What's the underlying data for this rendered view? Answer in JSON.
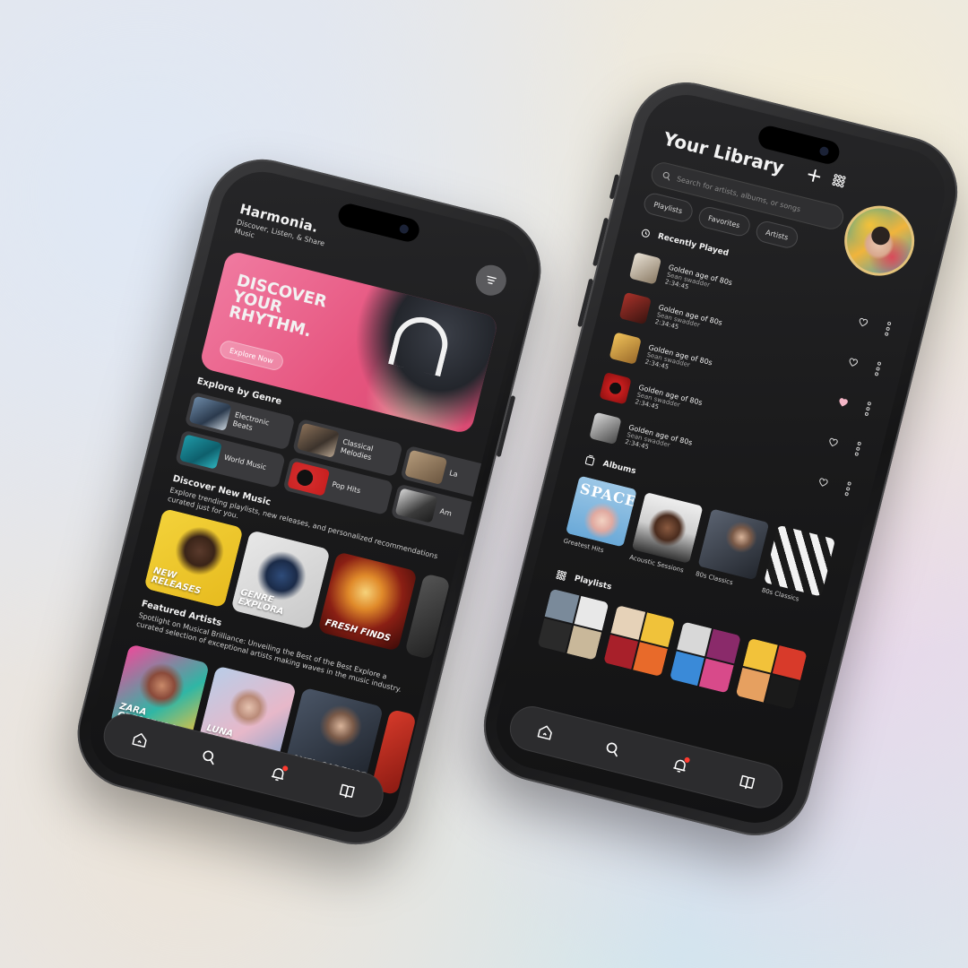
{
  "home": {
    "app_name": "Harmonia.",
    "tagline": "Discover, Listen, & Share Music",
    "hero": {
      "title": "DISCOVER YOUR RHYTHM.",
      "cta": "Explore Now"
    },
    "genre_section": {
      "title": "Explore by Genre",
      "rows": [
        [
          {
            "label": "Electronic Beats"
          },
          {
            "label": "Classical Melodies"
          },
          {
            "label": "La"
          }
        ],
        [
          {
            "label": "World Music"
          },
          {
            "label": "Pop Hits"
          },
          {
            "label": "Am"
          }
        ]
      ]
    },
    "discover_section": {
      "title": "Discover New Music",
      "subtitle": "Explore trending playlists, new releases, and personalized recommendations curated just for you.",
      "cards": [
        {
          "label": "NEW RELEASES"
        },
        {
          "label": "GENRE EXPLORA"
        },
        {
          "label": "FRESH FINDS"
        }
      ]
    },
    "artists_section": {
      "title": "Featured Artists",
      "subtitle": "Spotlight on Musical Brilliance: Unveiling the Best of the Best Explore a curated selection of exceptional artists making waves in the music industry.",
      "cards": [
        {
          "label": "ZARA CRESCENDO"
        },
        {
          "label": "LUNA SERENADE"
        },
        {
          "label": "AXEL CADENCE"
        }
      ]
    },
    "nav": {
      "home": "home",
      "search": "search",
      "notifications": "notifications",
      "library": "library"
    }
  },
  "library": {
    "title": "Your Library",
    "search_placeholder": "Search for artists, albums, or songs",
    "chips": [
      "Playlists",
      "Favorites",
      "Artists"
    ],
    "recent_title": "Recently Played",
    "tracks": [
      {
        "title": "Golden age of 80s",
        "artist": "Sean swadder",
        "duration": "2:34:45",
        "liked": false
      },
      {
        "title": "Golden age of 80s",
        "artist": "Sean swadder",
        "duration": "2:34:45",
        "liked": false
      },
      {
        "title": "Golden age of 80s",
        "artist": "Sean swadder",
        "duration": "2:34:45",
        "liked": true
      },
      {
        "title": "Golden age of 80s",
        "artist": "Sean swadder",
        "duration": "2:34:45",
        "liked": false
      },
      {
        "title": "Golden age of 80s",
        "artist": "Sean swadder",
        "duration": "2:34:45",
        "liked": false
      }
    ],
    "albums_title": "Albums",
    "albums": [
      {
        "name": "Greatest Hits",
        "cover_text": "SPACE"
      },
      {
        "name": "Acoustic Sessions"
      },
      {
        "name": "80s Classics"
      },
      {
        "name": "80s Classics"
      }
    ],
    "playlists_title": "Playlists"
  },
  "colors": {
    "background": "#e6e6ea",
    "screen": "#1a1a1b",
    "hero_pink": "#e6557f",
    "notification": "#ff3b30",
    "like_pink": "#f4b6c6"
  }
}
